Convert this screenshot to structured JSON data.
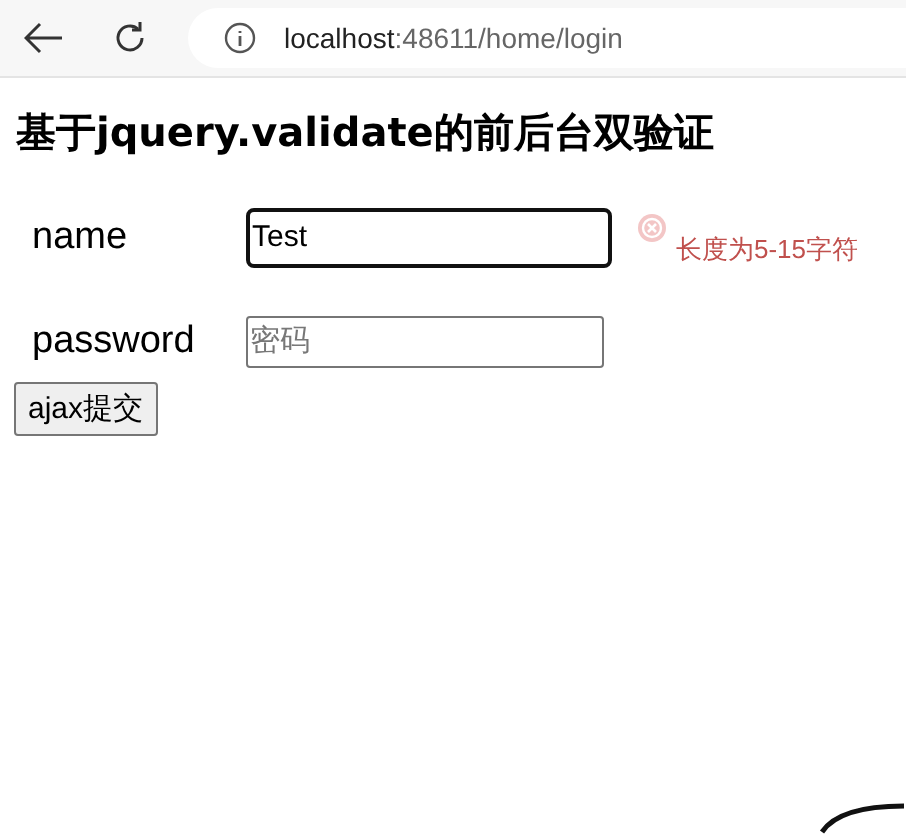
{
  "browser": {
    "url_host": "localhost",
    "url_rest": ":48611/home/login"
  },
  "heading": "基于jquery.validate的前后台双验证",
  "fields": [
    {
      "label": "name",
      "value": "Test",
      "focused": true,
      "error": "长度为5-15字符"
    },
    {
      "label": "password",
      "placeholder": "密码",
      "focused": false
    }
  ],
  "submit_button": "ajax提交"
}
